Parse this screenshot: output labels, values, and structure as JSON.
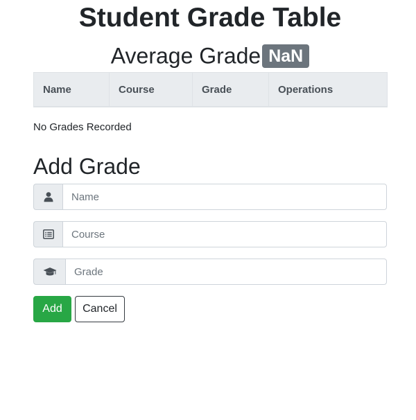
{
  "header": {
    "title": "Student Grade Table",
    "average_label": "Average Grade",
    "average_value": "NaN"
  },
  "table": {
    "columns": [
      "Name",
      "Course",
      "Grade",
      "Operations"
    ],
    "rows": [],
    "empty_message": "No Grades Recorded"
  },
  "form": {
    "title": "Add Grade",
    "name_placeholder": "Name",
    "course_placeholder": "Course",
    "grade_placeholder": "Grade",
    "add_label": "Add",
    "cancel_label": "Cancel",
    "icons": [
      "user-icon",
      "list-icon",
      "graduation-cap-icon"
    ]
  },
  "colors": {
    "badge": "#6c757d",
    "add_button": "#28a745",
    "table_header": "#e9ecef"
  }
}
